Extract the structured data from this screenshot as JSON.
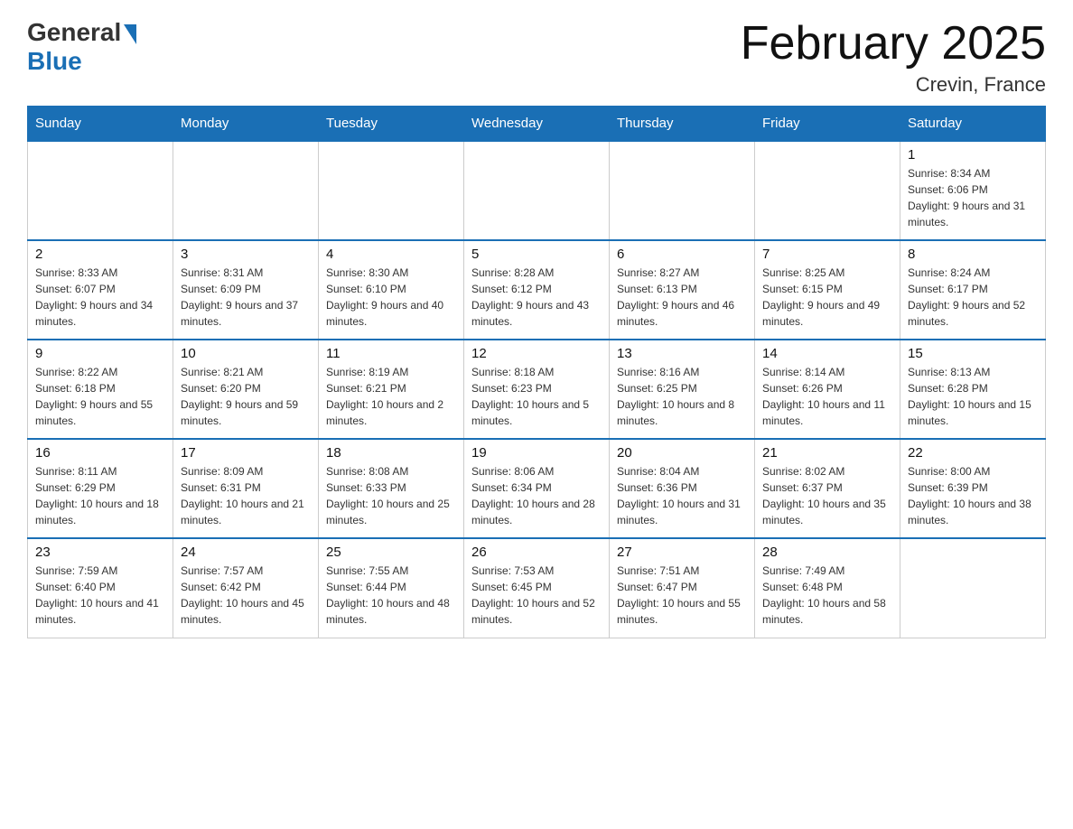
{
  "header": {
    "logo_general": "General",
    "logo_blue": "Blue",
    "month_title": "February 2025",
    "location": "Crevin, France"
  },
  "weekdays": [
    "Sunday",
    "Monday",
    "Tuesday",
    "Wednesday",
    "Thursday",
    "Friday",
    "Saturday"
  ],
  "weeks": [
    [
      {
        "day": "",
        "info": ""
      },
      {
        "day": "",
        "info": ""
      },
      {
        "day": "",
        "info": ""
      },
      {
        "day": "",
        "info": ""
      },
      {
        "day": "",
        "info": ""
      },
      {
        "day": "",
        "info": ""
      },
      {
        "day": "1",
        "info": "Sunrise: 8:34 AM\nSunset: 6:06 PM\nDaylight: 9 hours and 31 minutes."
      }
    ],
    [
      {
        "day": "2",
        "info": "Sunrise: 8:33 AM\nSunset: 6:07 PM\nDaylight: 9 hours and 34 minutes."
      },
      {
        "day": "3",
        "info": "Sunrise: 8:31 AM\nSunset: 6:09 PM\nDaylight: 9 hours and 37 minutes."
      },
      {
        "day": "4",
        "info": "Sunrise: 8:30 AM\nSunset: 6:10 PM\nDaylight: 9 hours and 40 minutes."
      },
      {
        "day": "5",
        "info": "Sunrise: 8:28 AM\nSunset: 6:12 PM\nDaylight: 9 hours and 43 minutes."
      },
      {
        "day": "6",
        "info": "Sunrise: 8:27 AM\nSunset: 6:13 PM\nDaylight: 9 hours and 46 minutes."
      },
      {
        "day": "7",
        "info": "Sunrise: 8:25 AM\nSunset: 6:15 PM\nDaylight: 9 hours and 49 minutes."
      },
      {
        "day": "8",
        "info": "Sunrise: 8:24 AM\nSunset: 6:17 PM\nDaylight: 9 hours and 52 minutes."
      }
    ],
    [
      {
        "day": "9",
        "info": "Sunrise: 8:22 AM\nSunset: 6:18 PM\nDaylight: 9 hours and 55 minutes."
      },
      {
        "day": "10",
        "info": "Sunrise: 8:21 AM\nSunset: 6:20 PM\nDaylight: 9 hours and 59 minutes."
      },
      {
        "day": "11",
        "info": "Sunrise: 8:19 AM\nSunset: 6:21 PM\nDaylight: 10 hours and 2 minutes."
      },
      {
        "day": "12",
        "info": "Sunrise: 8:18 AM\nSunset: 6:23 PM\nDaylight: 10 hours and 5 minutes."
      },
      {
        "day": "13",
        "info": "Sunrise: 8:16 AM\nSunset: 6:25 PM\nDaylight: 10 hours and 8 minutes."
      },
      {
        "day": "14",
        "info": "Sunrise: 8:14 AM\nSunset: 6:26 PM\nDaylight: 10 hours and 11 minutes."
      },
      {
        "day": "15",
        "info": "Sunrise: 8:13 AM\nSunset: 6:28 PM\nDaylight: 10 hours and 15 minutes."
      }
    ],
    [
      {
        "day": "16",
        "info": "Sunrise: 8:11 AM\nSunset: 6:29 PM\nDaylight: 10 hours and 18 minutes."
      },
      {
        "day": "17",
        "info": "Sunrise: 8:09 AM\nSunset: 6:31 PM\nDaylight: 10 hours and 21 minutes."
      },
      {
        "day": "18",
        "info": "Sunrise: 8:08 AM\nSunset: 6:33 PM\nDaylight: 10 hours and 25 minutes."
      },
      {
        "day": "19",
        "info": "Sunrise: 8:06 AM\nSunset: 6:34 PM\nDaylight: 10 hours and 28 minutes."
      },
      {
        "day": "20",
        "info": "Sunrise: 8:04 AM\nSunset: 6:36 PM\nDaylight: 10 hours and 31 minutes."
      },
      {
        "day": "21",
        "info": "Sunrise: 8:02 AM\nSunset: 6:37 PM\nDaylight: 10 hours and 35 minutes."
      },
      {
        "day": "22",
        "info": "Sunrise: 8:00 AM\nSunset: 6:39 PM\nDaylight: 10 hours and 38 minutes."
      }
    ],
    [
      {
        "day": "23",
        "info": "Sunrise: 7:59 AM\nSunset: 6:40 PM\nDaylight: 10 hours and 41 minutes."
      },
      {
        "day": "24",
        "info": "Sunrise: 7:57 AM\nSunset: 6:42 PM\nDaylight: 10 hours and 45 minutes."
      },
      {
        "day": "25",
        "info": "Sunrise: 7:55 AM\nSunset: 6:44 PM\nDaylight: 10 hours and 48 minutes."
      },
      {
        "day": "26",
        "info": "Sunrise: 7:53 AM\nSunset: 6:45 PM\nDaylight: 10 hours and 52 minutes."
      },
      {
        "day": "27",
        "info": "Sunrise: 7:51 AM\nSunset: 6:47 PM\nDaylight: 10 hours and 55 minutes."
      },
      {
        "day": "28",
        "info": "Sunrise: 7:49 AM\nSunset: 6:48 PM\nDaylight: 10 hours and 58 minutes."
      },
      {
        "day": "",
        "info": ""
      }
    ]
  ]
}
